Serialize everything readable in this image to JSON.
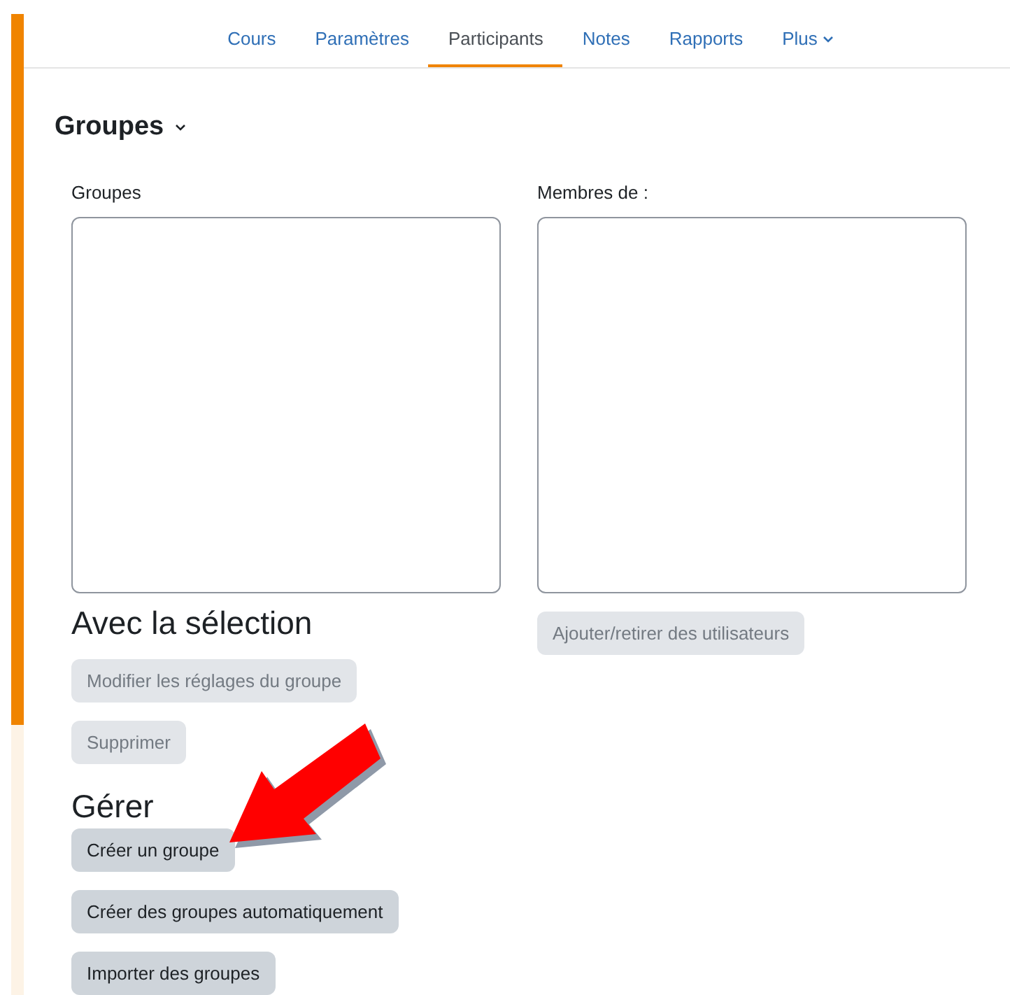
{
  "nav": {
    "tabs": [
      {
        "label": "Cours",
        "selected": false
      },
      {
        "label": "Paramètres",
        "selected": false
      },
      {
        "label": "Participants",
        "selected": true
      },
      {
        "label": "Notes",
        "selected": false
      },
      {
        "label": "Rapports",
        "selected": false
      },
      {
        "label": "Plus",
        "selected": false,
        "dropdown": true
      }
    ]
  },
  "page_title": "Groupes",
  "groups_list": {
    "label": "Groupes"
  },
  "members_list": {
    "label": "Membres de :"
  },
  "members_button": {
    "label": "Ajouter/retirer des utilisateurs",
    "disabled": true
  },
  "selection_section": {
    "title": "Avec la sélection",
    "buttons": [
      {
        "label": "Modifier les réglages du groupe",
        "disabled": true
      },
      {
        "label": "Supprimer",
        "disabled": true
      }
    ]
  },
  "manage_section": {
    "title": "Gérer",
    "buttons": [
      {
        "label": "Créer un groupe",
        "disabled": false
      },
      {
        "label": "Créer des groupes automatiquement",
        "disabled": false
      },
      {
        "label": "Importer des groupes",
        "disabled": false
      }
    ]
  }
}
